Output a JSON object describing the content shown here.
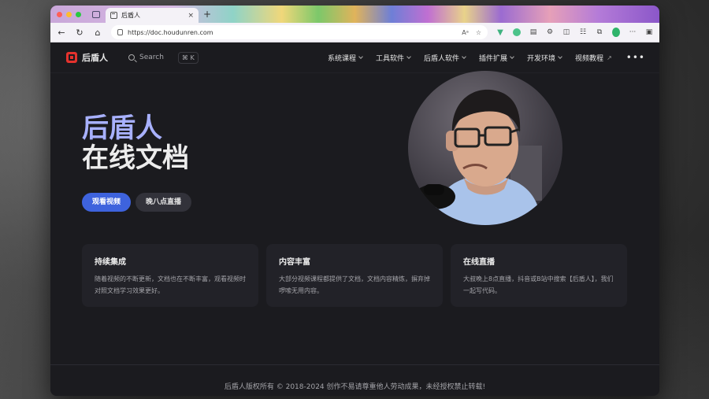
{
  "browser": {
    "tab_title": "后盾人",
    "tab_close": "×",
    "new_tab": "+",
    "url": "https://doc.houdunren.com"
  },
  "site": {
    "logo_text": "后盾人",
    "search": {
      "placeholder": "Search",
      "shortcut": "⌘ K"
    },
    "nav": [
      {
        "label": "系统课程",
        "dropdown": true
      },
      {
        "label": "工具软件",
        "dropdown": true
      },
      {
        "label": "后盾人软件",
        "dropdown": true
      },
      {
        "label": "插件扩展",
        "dropdown": true
      },
      {
        "label": "开发环境",
        "dropdown": true
      },
      {
        "label": "视频教程",
        "external": true
      }
    ],
    "more": "•••"
  },
  "hero": {
    "title_line1": "后盾人",
    "title_line2": "在线文档",
    "primary_button": "观看视频",
    "secondary_button": "晚八点直播"
  },
  "features": [
    {
      "title": "持续集成",
      "text": "随着视频的不断更新，文档也在不断丰富，观看视频时对照文档学习效果更好。"
    },
    {
      "title": "内容丰富",
      "text": "大部分视频课程都提供了文档，文档内容精炼，摒弃掉啰嗦无用内容。"
    },
    {
      "title": "在线直播",
      "text": "大叔晚上8点直播，抖音或B站中搜索【后盾人】，我们一起写代码。"
    }
  ],
  "footer": {
    "text": "后盾人版权所有 © 2018-2024 创作不易请尊重他人劳动成果，未经授权禁止转载!"
  },
  "colors": {
    "accent": "#3e63dd",
    "hero_highlight": "#a8b1ff",
    "logo": "#e5322d",
    "background": "#1b1b1f"
  }
}
